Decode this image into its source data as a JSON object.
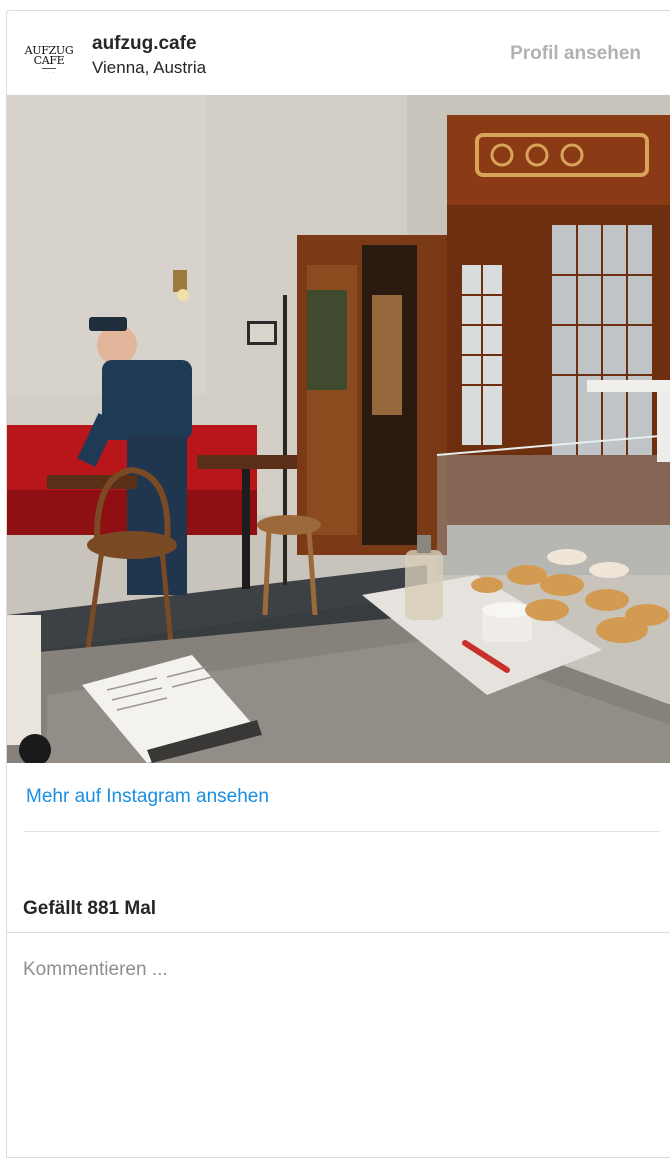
{
  "post": {
    "username": "aufzug.cafe",
    "location": "Vienna, Austria",
    "view_profile_label": "Profil ansehen",
    "avatar_logo": {
      "line1": "AUFZUG",
      "line2": "CAFE"
    },
    "image_alt": "Café interior with a bellboy, wooden elevator cabins and pastries",
    "more_label": "Mehr auf Instagram ansehen",
    "likes_label": "Gefällt 881 Mal",
    "comment_placeholder": "Kommentieren ..."
  },
  "colors": {
    "link_blue": "#1a8ee0",
    "muted_gray": "#b2b2b2",
    "text": "#262626",
    "border": "#dbdbdb"
  }
}
